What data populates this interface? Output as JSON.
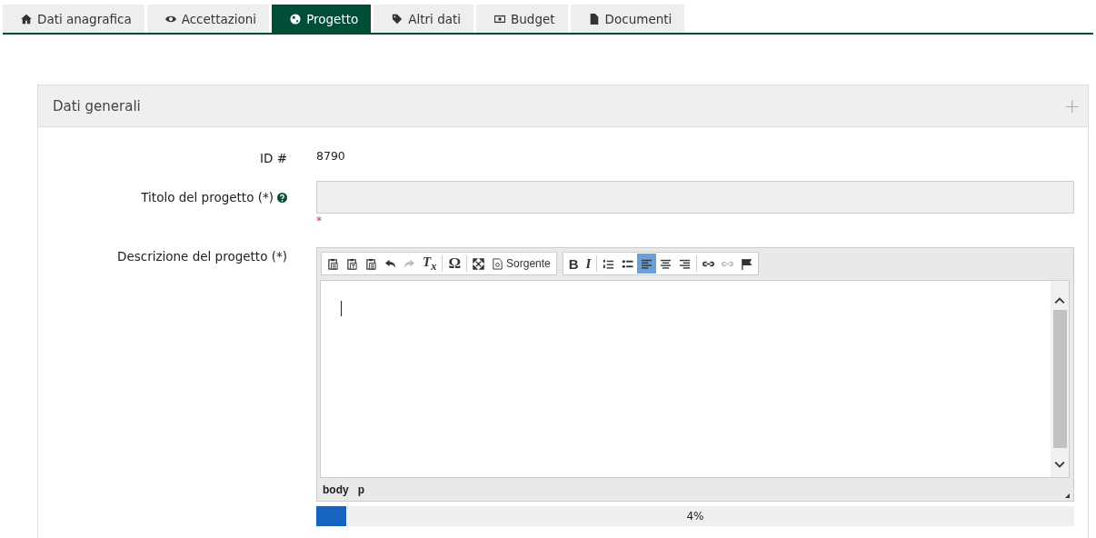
{
  "tabs": [
    {
      "label": "Dati anagrafica",
      "kind": "home",
      "selected": false
    },
    {
      "label": "Accettazioni",
      "kind": "eye",
      "selected": false
    },
    {
      "label": "Progetto",
      "kind": "globe",
      "selected": true
    },
    {
      "label": "Altri dati",
      "kind": "tags",
      "selected": false
    },
    {
      "label": "Budget",
      "kind": "money",
      "selected": false
    },
    {
      "label": "Documenti",
      "kind": "file",
      "selected": false
    }
  ],
  "panel": {
    "title": "Dati generali",
    "expand_symbol": "+",
    "id_field": {
      "label": "ID #",
      "value": "8790"
    },
    "title_field": {
      "label": "Titolo del progetto (*)",
      "required_mark": "*"
    },
    "description": {
      "label": "Descrizione del progetto (*)",
      "toolbar": [
        [
          [
            {
              "kind": "paste",
              "active": false,
              "disabled": false
            },
            {
              "kind": "paste-text",
              "active": false,
              "disabled": false
            },
            {
              "kind": "paste-word",
              "active": false,
              "disabled": false
            },
            {
              "kind": "undo",
              "active": false,
              "disabled": false
            },
            {
              "kind": "redo",
              "active": false,
              "disabled": true
            },
            {
              "kind": "remove-format",
              "label": "T$_{x}$",
              "active": false,
              "disabled": false
            }
          ],
          [
            {
              "kind": "special-char",
              "label": "Ω",
              "active": false,
              "disabled": false
            }
          ],
          [
            {
              "kind": "maximize",
              "active": false,
              "disabled": false
            },
            {
              "kind": "source",
              "label": "Sorgente",
              "active": false,
              "disabled": false
            }
          ]
        ],
        [
          [
            {
              "kind": "bold",
              "label": "B",
              "active": false,
              "disabled": false
            },
            {
              "kind": "italic",
              "label": "I",
              "active": false,
              "disabled": false
            }
          ],
          [
            {
              "kind": "numbered-list",
              "active": false,
              "disabled": false
            },
            {
              "kind": "bulleted-list",
              "active": false,
              "disabled": false
            },
            {
              "kind": "align-left",
              "active": true,
              "disabled": false
            },
            {
              "kind": "align-center",
              "active": false,
              "disabled": false
            },
            {
              "kind": "align-right",
              "active": false,
              "disabled": false
            }
          ],
          [
            {
              "kind": "link",
              "active": false,
              "disabled": false
            },
            {
              "kind": "unlink",
              "active": false,
              "disabled": true
            },
            {
              "kind": "anchor",
              "active": false,
              "disabled": false
            }
          ]
        ]
      ],
      "path": [
        "body",
        "p"
      ]
    },
    "progress": {
      "level": 0.04,
      "reading": "4%"
    }
  }
}
